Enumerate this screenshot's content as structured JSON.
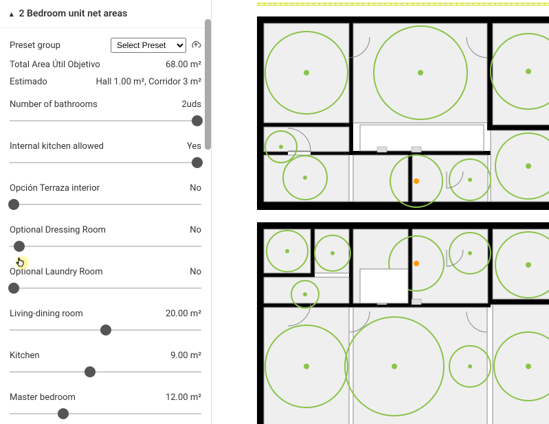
{
  "section": {
    "title": "2 Bedroom unit net areas"
  },
  "preset": {
    "label": "Preset group",
    "select_placeholder": "Select Preset"
  },
  "info": {
    "total_label": "Total Area Útil Objetivo",
    "total_value": "68.00 m²",
    "estimado_label": "Estimado",
    "estimado_value": "Hall 1.00 m², Corridor 3 m²"
  },
  "sliders": {
    "bathrooms": {
      "label": "Number of bathrooms",
      "value": "2uds",
      "thumb_pct": 98
    },
    "kitchen_internal": {
      "label": "Internal kitchen allowed",
      "value": "Yes",
      "thumb_pct": 98
    },
    "terraza": {
      "label": "Opción Terraza interior",
      "value": "No",
      "thumb_pct": 2
    },
    "dressing": {
      "label": "Optional Dressing Room",
      "value": "No",
      "thumb_pct": 5
    },
    "laundry": {
      "label": "Optional Laundry Room",
      "value": "No",
      "thumb_pct": 2
    },
    "living": {
      "label": "Living-dining room",
      "value": "20.00  m²",
      "thumb_pct": 50
    },
    "kitchen": {
      "label": "Kitchen",
      "value": "9.00  m²",
      "thumb_pct": 42
    },
    "master": {
      "label": "Master bedroom",
      "value": "12.00  m²",
      "thumb_pct": 28
    }
  }
}
